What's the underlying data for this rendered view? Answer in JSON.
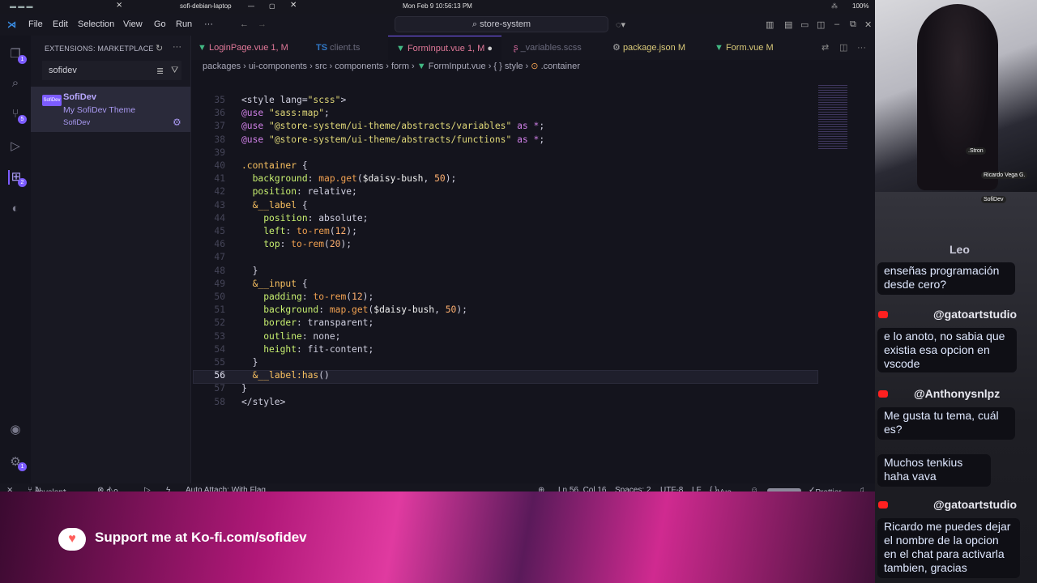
{
  "system_bar": {
    "hostname": "sofi-debian-laptop",
    "datetime": "Mon Feb 9  10:56:13 PM",
    "battery": "100%"
  },
  "menu": [
    "File",
    "Edit",
    "Selection",
    "View",
    "Go",
    "Run",
    "···"
  ],
  "command_center": "store-system",
  "sidebar": {
    "title": "EXTENSIONS: MARKETPLACE",
    "search_value": "sofidev",
    "extension": {
      "name": "SofiDev",
      "description": "My SofiDev Theme",
      "publisher": "SofiDev"
    }
  },
  "activity_badges": {
    "scm": "5",
    "extensions": "2",
    "settings": "1"
  },
  "tabs": [
    {
      "label": "LoginPage.vue",
      "status": "1, M",
      "color": "#e07898"
    },
    {
      "label": "client.ts",
      "status": "",
      "color": "#6a6a7c"
    },
    {
      "label": "FormInput.vue",
      "status": "1, M",
      "color": "#e07898"
    },
    {
      "label": "_variables.scss",
      "status": "",
      "color": "#6a6a7c"
    },
    {
      "label": "package.json",
      "status": "M",
      "color": "#d8c878"
    },
    {
      "label": "Form.vue",
      "status": "M",
      "color": "#d8c878"
    }
  ],
  "breadcrumb": [
    "packages",
    "ui-components",
    "src",
    "components",
    "form",
    "FormInput.vue",
    "{ } style",
    ".container"
  ],
  "code_lines": [
    {
      "n": "35",
      "text": "<style lang=\"scss\">"
    },
    {
      "n": "36",
      "text": "@use \"sass:map\";"
    },
    {
      "n": "37",
      "text": "@use \"@store-system/ui-theme/abstracts/variables\" as *;"
    },
    {
      "n": "38",
      "text": "@use \"@store-system/ui-theme/abstracts/functions\" as *;"
    },
    {
      "n": "39",
      "text": ""
    },
    {
      "n": "40",
      "text": ".container {"
    },
    {
      "n": "41",
      "text": "  background: map.get($daisy-bush, 50);"
    },
    {
      "n": "42",
      "text": "  position: relative;"
    },
    {
      "n": "43",
      "text": "  &__label {"
    },
    {
      "n": "44",
      "text": "    position: absolute;"
    },
    {
      "n": "45",
      "text": "    left: to-rem(12);"
    },
    {
      "n": "46",
      "text": "    top: to-rem(20);"
    },
    {
      "n": "47",
      "text": ""
    },
    {
      "n": "48",
      "text": "  }"
    },
    {
      "n": "49",
      "text": "  &__input {"
    },
    {
      "n": "50",
      "text": "    padding: to-rem(12);"
    },
    {
      "n": "51",
      "text": "    background: map.get($daisy-bush, 50);"
    },
    {
      "n": "52",
      "text": "    border: transparent;"
    },
    {
      "n": "53",
      "text": "    outline: none;"
    },
    {
      "n": "54",
      "text": "    height: fit-content;"
    },
    {
      "n": "55",
      "text": "  }"
    },
    {
      "n": "56",
      "text": "  &__label:has()"
    },
    {
      "n": "57",
      "text": "}"
    },
    {
      "n": "58",
      "text": "</style>"
    }
  ],
  "statusbar": {
    "branch": "develop*",
    "errors": "2",
    "warnings": "0",
    "auto_attach": "Auto Attach: With Flag",
    "position": "Ln 56, Col 16",
    "spaces": "Spaces: 2",
    "encoding": "UTF-8",
    "eol": "LF",
    "language": "Vue",
    "formatter": "Prettier"
  },
  "banner": {
    "kofi_text": "Support me at Ko-fi.com/sofidev"
  },
  "camera": {
    "tag1": ".Stron",
    "tag2": "Ricardo Vega G.",
    "tag3": "SofiDev"
  },
  "chat": [
    {
      "user": "Leo",
      "message": "enseñas programación desde cero?"
    },
    {
      "user": "@gatoartstudio",
      "message": "e lo anoto, no sabia que existia esa opcion en vscode"
    },
    {
      "user": "@Anthonysnlpz",
      "message": "Me gusta tu tema, cuál es?"
    },
    {
      "user": "",
      "message": "Muchos tenkius haha vava"
    },
    {
      "user": "@gatoartstudio",
      "message": "Ricardo me puedes dejar el nombre de la opcion en el chat para activarla tambien, gracias"
    }
  ],
  "colors": {
    "accent": "#7c5cff",
    "keyword": "#d080e8",
    "string": "#e0d878",
    "function": "#f0a050",
    "property": "#c8f070",
    "number": "#ffb070",
    "selector": "#f8c060"
  }
}
